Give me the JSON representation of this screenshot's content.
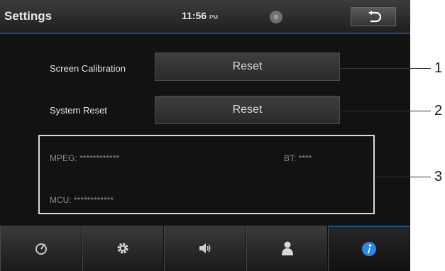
{
  "header": {
    "title": "Settings",
    "time": "11:56",
    "ampm": "PM",
    "disc_icon": "disc-icon",
    "back_icon": "back-arrow-icon"
  },
  "rows": [
    {
      "label": "Screen Calibration",
      "button": "Reset"
    },
    {
      "label": "System Reset",
      "button": "Reset"
    }
  ],
  "version": {
    "mpeg": "MPEG: ************",
    "bt": "BT: ****",
    "mcu": "MCU: ************"
  },
  "navbar": {
    "items": [
      {
        "icon": "gauge-icon"
      },
      {
        "icon": "gear-icon"
      },
      {
        "icon": "speaker-icon"
      },
      {
        "icon": "person-icon"
      },
      {
        "icon": "info-icon",
        "active": true
      }
    ]
  },
  "callouts": [
    "1",
    "2",
    "3"
  ],
  "colors": {
    "accent": "#2f86e0",
    "screen_bg": "#121212",
    "header_line": "#1f4f82"
  }
}
